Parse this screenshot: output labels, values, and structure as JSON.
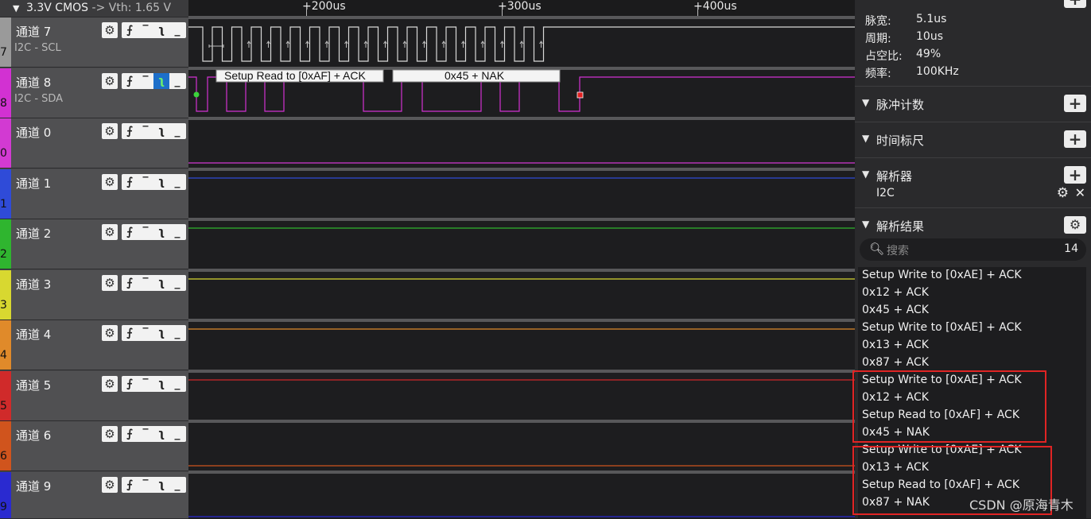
{
  "header": {
    "voltage": "3.3V CMOS",
    "vth": "-> Vth: 1.65 V"
  },
  "ruler": {
    "ticks": [
      "+200us",
      "+300us",
      "+400us"
    ]
  },
  "channels": [
    {
      "name": "通道 7",
      "sub": "I2C - SCL",
      "num": "7",
      "color": "#9a9a9a"
    },
    {
      "name": "通道 8",
      "sub": "I2C - SDA",
      "num": "8",
      "color": "#d231d2"
    },
    {
      "name": "通道 0",
      "sub": "",
      "num": "0",
      "color": "#d23ad2"
    },
    {
      "name": "通道 1",
      "sub": "",
      "num": "1",
      "color": "#2f4bd8"
    },
    {
      "name": "通道 2",
      "sub": "",
      "num": "2",
      "color": "#2fb52f"
    },
    {
      "name": "通道 3",
      "sub": "",
      "num": "3",
      "color": "#d8d830"
    },
    {
      "name": "通道 4",
      "sub": "",
      "num": "4",
      "color": "#e08a2a"
    },
    {
      "name": "通道 5",
      "sub": "",
      "num": "5",
      "color": "#d02a2a"
    },
    {
      "name": "通道 6",
      "sub": "",
      "num": "6",
      "color": "#d0541d"
    },
    {
      "name": "通道 9",
      "sub": "",
      "num": "9",
      "color": "#2a2ad0"
    }
  ],
  "trigger_icons": {
    "gear": "⚙",
    "rise": "⨍",
    "high": "‾",
    "fall": "ʅ",
    "low": "_"
  },
  "decode": {
    "seg1": "Setup Read to [0xAF] + ACK",
    "seg2": "0x45 + NAK"
  },
  "measurements": [
    {
      "label": "脉宽:",
      "value": "5.1us"
    },
    {
      "label": "周期:",
      "value": "10us"
    },
    {
      "label": "占空比:",
      "value": "49%"
    },
    {
      "label": "频率:",
      "value": "100KHz"
    }
  ],
  "sections": {
    "pulse_count": "脉冲计数",
    "time_ruler": "时间标尺",
    "analyzer": "解析器",
    "analyzer_item": "I2C",
    "results": "解析结果"
  },
  "search": {
    "placeholder": "搜索",
    "count": "14"
  },
  "results": [
    "Setup Write to [0xAE] + ACK",
    "0x12 + ACK",
    "0x45 + ACK",
    "Setup Write to [0xAE] + ACK",
    "0x13 + ACK",
    "0x87 + ACK",
    "Setup Write to [0xAE] + ACK",
    "0x12 + ACK",
    "Setup Read to [0xAF] + ACK",
    "0x45 + NAK",
    "Setup Write to [0xAE] + ACK",
    "0x13 + ACK",
    "Setup Read to [0xAF] + ACK",
    "0x87 + NAK"
  ],
  "watermark": "CSDN @原海青木"
}
